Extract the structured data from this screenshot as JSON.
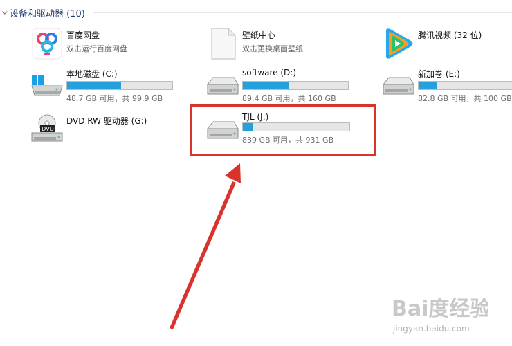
{
  "group": {
    "title": "设备和驱动器 (10)"
  },
  "items": {
    "baidu_netdisk": {
      "name": "百度网盘",
      "sub": "双击运行百度网盘"
    },
    "wallpaper": {
      "name": "壁纸中心",
      "sub": "双击更换桌面壁纸"
    },
    "tencent_video": {
      "name": "腾讯视频 (32 位)"
    },
    "drive_c": {
      "name": "本地磁盘 (C:)",
      "free": "48.7 GB 可用，共 99.9 GB",
      "used_fraction": 0.51
    },
    "drive_d": {
      "name": "software (D:)",
      "free": "89.4 GB 可用，共 160 GB",
      "used_fraction": 0.44
    },
    "drive_e": {
      "name": "新加卷 (E:)",
      "free": "82.8 GB 可用，共 100 GB",
      "used_fraction": 0.17
    },
    "drive_g": {
      "name": "DVD RW 驱动器 (G:)",
      "badge": "DVD"
    },
    "drive_j": {
      "name": "TJL (J:)",
      "free": "839 GB 可用，共 931 GB",
      "used_fraction": 0.1
    }
  },
  "watermark": {
    "logo": "Bai度经验",
    "url": "jingyan.baidu.com"
  },
  "colors": {
    "bar_fill": "#26a0da",
    "highlight": "#d9332e",
    "header_text": "#1e3a6e"
  },
  "icons": {
    "baidu_netdisk": "baidu-netdisk-icon",
    "wallpaper": "blank-document-icon",
    "tencent_video": "tencent-video-icon",
    "windows_drive": "windows-drive-icon",
    "hard_drive": "hard-drive-icon",
    "dvd_drive": "dvd-drive-icon"
  }
}
